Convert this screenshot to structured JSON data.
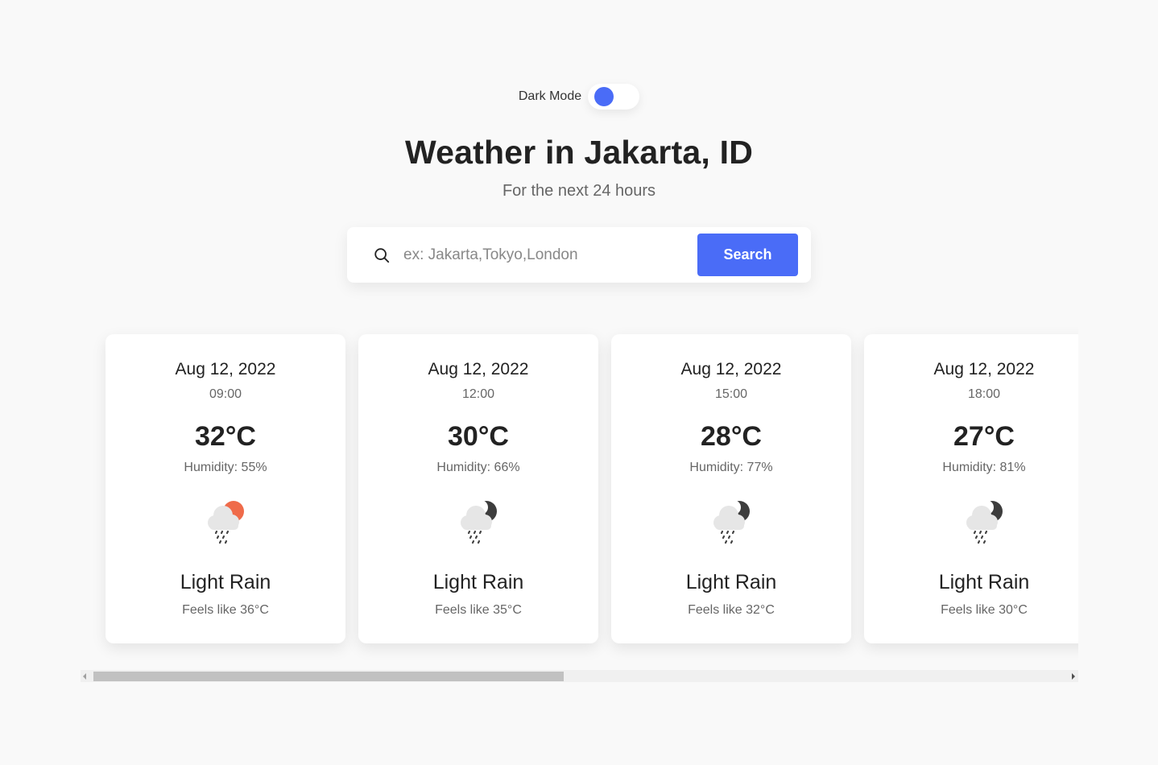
{
  "dark_mode": {
    "label": "Dark Mode",
    "enabled": false,
    "accent": "#4a6cf7"
  },
  "header": {
    "title": "Weather in Jakarta, ID",
    "subtitle": "For the next 24 hours"
  },
  "search": {
    "placeholder": "ex: Jakarta,Tokyo,London",
    "value": "",
    "button_label": "Search",
    "icon": "search-icon"
  },
  "forecast": [
    {
      "date": "Aug 12, 2022",
      "time": "09:00",
      "temp": "32°C",
      "humidity": "Humidity: 55%",
      "icon": "sun-cloud-rain-icon",
      "condition": "Light Rain",
      "feels_like": "Feels like 36°C"
    },
    {
      "date": "Aug 12, 2022",
      "time": "12:00",
      "temp": "30°C",
      "humidity": "Humidity: 66%",
      "icon": "moon-cloud-rain-icon",
      "condition": "Light Rain",
      "feels_like": "Feels like 35°C"
    },
    {
      "date": "Aug 12, 2022",
      "time": "15:00",
      "temp": "28°C",
      "humidity": "Humidity: 77%",
      "icon": "moon-cloud-rain-icon",
      "condition": "Light Rain",
      "feels_like": "Feels like 32°C"
    },
    {
      "date": "Aug 12, 2022",
      "time": "18:00",
      "temp": "27°C",
      "humidity": "Humidity: 81%",
      "icon": "moon-cloud-rain-icon",
      "condition": "Light Rain",
      "feels_like": "Feels like 30°C"
    }
  ],
  "colors": {
    "sun": "#ef6b4a",
    "moon": "#3d3d3d",
    "cloud": "#e6e6e6",
    "rain": "#444444"
  }
}
